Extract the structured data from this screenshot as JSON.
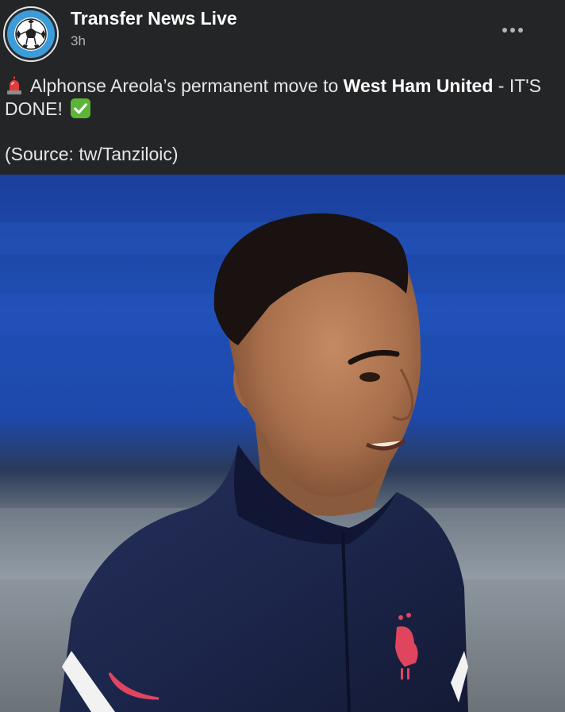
{
  "post": {
    "page_name": "Transfer News Live",
    "timestamp": "3h",
    "avatar_icon": "soccer-ball-icon",
    "more_icon": "more-dots-icon",
    "text": {
      "siren_icon": "siren-icon",
      "part1": "Alphonse Areola’s permanent move to ",
      "highlight": "West Ham United",
      "part2": " - IT'S DONE! ",
      "check_icon": "check-mark-icon"
    },
    "source": "(Source: tw/Tanziloic)"
  },
  "photo": {
    "subject": "player-photo",
    "colors": {
      "background_blue": "#1f4fb5",
      "jersey_navy": "#1b2448",
      "skin": "#a86f4c",
      "hair": "#1a1210",
      "logo_pink": "#e0455f"
    }
  },
  "theme": {
    "background": "#242526",
    "text_primary": "#e4e6eb",
    "text_secondary": "#b0b3b8",
    "accent": "#3b9cd9"
  }
}
